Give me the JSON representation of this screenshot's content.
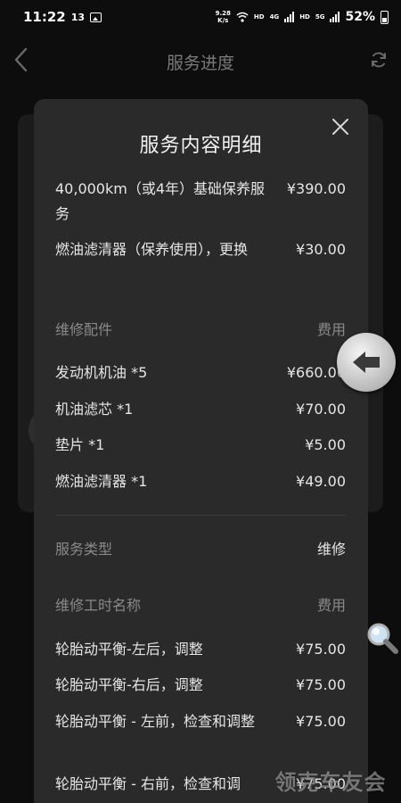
{
  "status_bar": {
    "time": "11:22",
    "notif_count": "13",
    "net_speed_value": "9.28",
    "net_speed_unit": "K/s",
    "hd1": "HD",
    "net1": "4G",
    "hd2": "HD",
    "net2": "5G",
    "battery": "52%"
  },
  "header": {
    "title": "服务进度"
  },
  "modal": {
    "title": "服务内容明细",
    "packages": [
      {
        "name": "40,000km（或4年）基础保养服务",
        "price": "¥390.00"
      },
      {
        "name": "燃油滤清器（保养使用），更换",
        "price": "¥30.00"
      }
    ],
    "parts_header": {
      "label": "维修配件",
      "fee_label": "费用"
    },
    "parts": [
      {
        "name": "发动机机油 *5",
        "price": "¥660.00"
      },
      {
        "name": "机油滤芯 *1",
        "price": "¥70.00"
      },
      {
        "name": "垫片 *1",
        "price": "¥5.00"
      },
      {
        "name": "燃油滤清器 *1",
        "price": "¥49.00"
      }
    ],
    "service_type": {
      "label": "服务类型",
      "value": "维修"
    },
    "labor_header": {
      "label": "维修工时名称",
      "fee_label": "费用"
    },
    "labor": [
      {
        "name": "轮胎动平衡-左后，调整",
        "price": "¥75.00"
      },
      {
        "name": "轮胎动平衡-右后，调整",
        "price": "¥75.00"
      },
      {
        "name": "轮胎动平衡 - 左前，检查和调整",
        "price": "¥75.00"
      },
      {
        "name": "轮胎动平衡 - 右前，检查和调",
        "price": "¥75.00"
      }
    ]
  },
  "watermark": "领克车友会",
  "icons": {
    "back": "back-chevron-icon",
    "refresh": "refresh-icon",
    "close": "close-icon",
    "float_back": "back-arrow-icon",
    "float_search": "magnifier-icon"
  }
}
